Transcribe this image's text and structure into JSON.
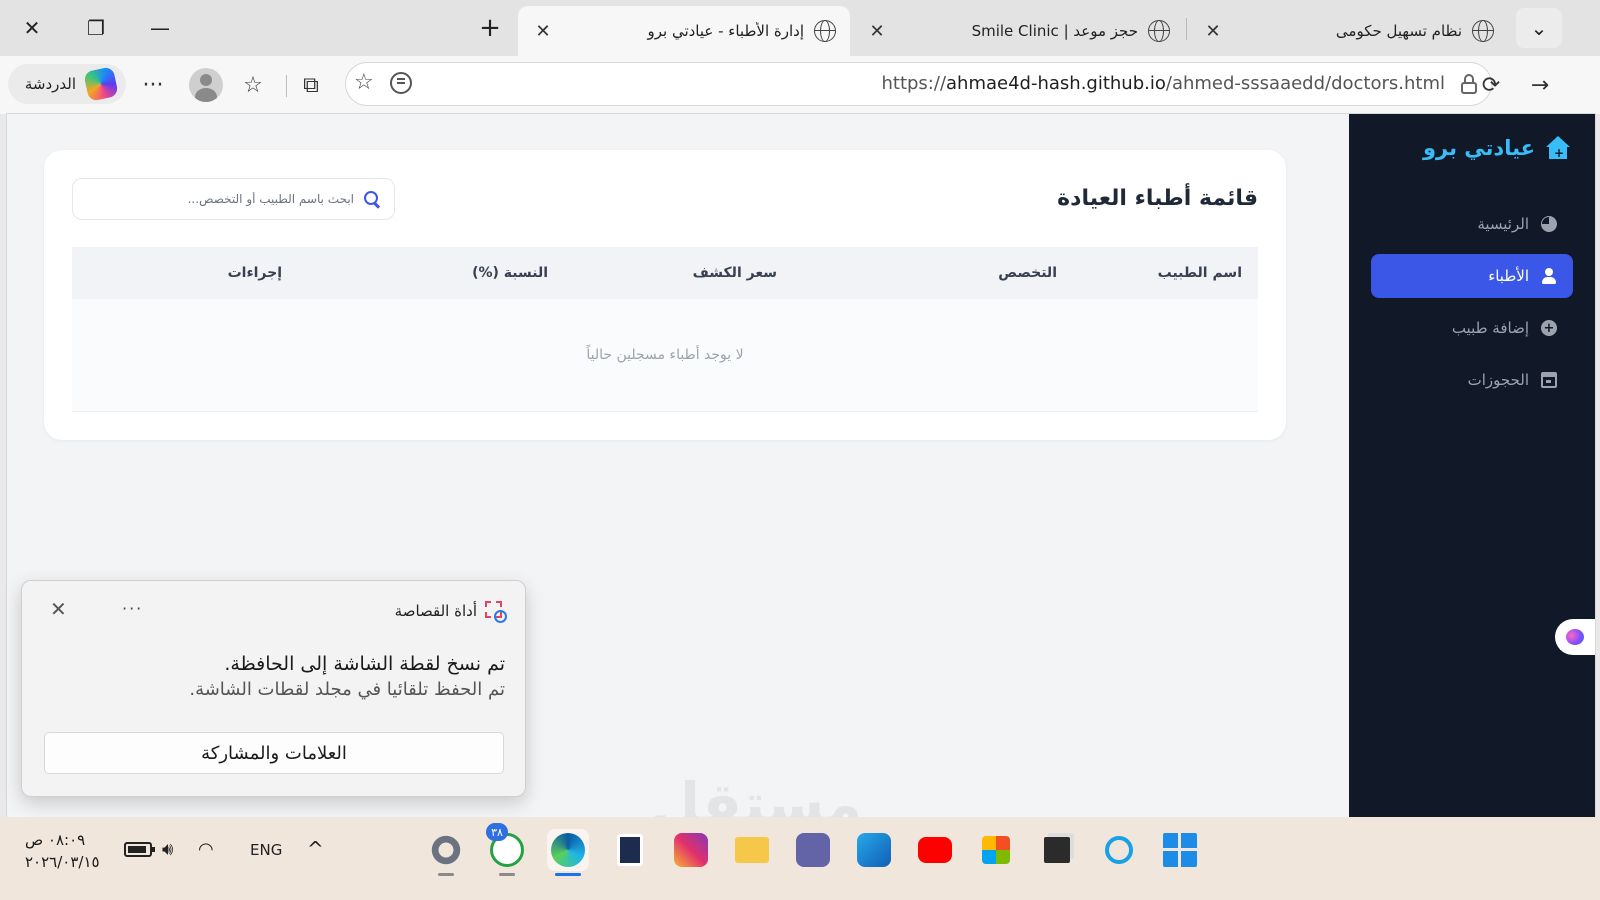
{
  "browser": {
    "tabs": [
      {
        "title": "نظام تسهيل حكومى",
        "active": false
      },
      {
        "title": "حجز موعد | Smile Clinic",
        "active": false
      },
      {
        "title": "إدارة الأطباء - عيادتي برو",
        "active": true
      }
    ],
    "window_controls": {
      "minimize_icon": "minimize-icon",
      "restore_icon": "restore-icon",
      "close_icon": "close-icon"
    },
    "address": {
      "protocol": "https://",
      "host": "ahmae4d-hash.github.io",
      "path": "/ahmed-sssaaedd/doctors.html"
    },
    "copilot_label": "الدردشة"
  },
  "app": {
    "brand": "عيادتي برو",
    "nav": [
      {
        "label": "الرئيسية",
        "icon": "pie-chart-icon",
        "active": false
      },
      {
        "label": "الأطباء",
        "icon": "user-doctor-icon",
        "active": true
      },
      {
        "label": "إضافة طبيب",
        "icon": "plus-circle-icon",
        "active": false
      },
      {
        "label": "الحجوزات",
        "icon": "calendar-icon",
        "active": false
      }
    ],
    "accent_color": "#3b57e8",
    "sidebar_color": "#111827",
    "page_title": "قائمة أطباء العيادة",
    "search": {
      "placeholder": "ابحث باسم الطبيب أو التخصص...",
      "value": ""
    },
    "table": {
      "columns": [
        "اسم الطبيب",
        "التخصص",
        "سعر الكشف",
        "النسبة (%)",
        "إجراءات"
      ],
      "rows": [],
      "empty_message": "لا يوجد أطباء مسجلين حالياً"
    }
  },
  "toast": {
    "app_name": "أداة القصاصة",
    "line1": "تم نسخ لقطة الشاشة إلى الحافظة.",
    "line2": "تم الحفظ تلقائيا في مجلد لقطات الشاشة.",
    "button": "العلامات والمشاركة",
    "more": "···",
    "close": "✕"
  },
  "watermark": "مستقل",
  "taskbar": {
    "time": "٠٨:٠٩ ص",
    "date": "٢٠٢٦/٠٣/١٥",
    "language": "ENG",
    "whatsapp_badge": "٣٨",
    "apps": [
      "settings-icon",
      "whatsapp-icon",
      "edge-icon",
      "solitaire-icon",
      "instagram-icon",
      "file-explorer-icon",
      "teams-icon",
      "outlook-icon",
      "youtube-icon",
      "store-icon",
      "app-icon",
      "search-icon",
      "start-icon"
    ]
  }
}
